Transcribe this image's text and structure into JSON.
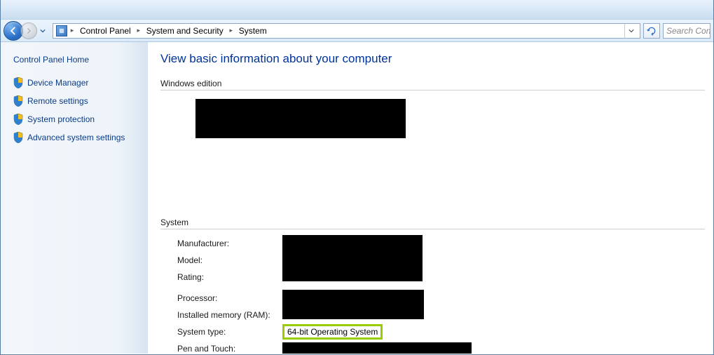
{
  "breadcrumb": {
    "items": [
      "Control Panel",
      "System and Security",
      "System"
    ]
  },
  "search": {
    "placeholder": "Search Cont"
  },
  "sidebar": {
    "home": "Control Panel Home",
    "links": [
      "Device Manager",
      "Remote settings",
      "System protection",
      "Advanced system settings"
    ]
  },
  "page": {
    "title": "View basic information about your computer",
    "windows_edition_header": "Windows edition",
    "system_header": "System",
    "rows": {
      "manufacturer": "Manufacturer:",
      "model": "Model:",
      "rating": "Rating:",
      "processor": "Processor:",
      "ram": "Installed memory (RAM):",
      "system_type": "System type:",
      "system_type_value": "64-bit Operating System",
      "pen_touch": "Pen and Touch:"
    }
  }
}
